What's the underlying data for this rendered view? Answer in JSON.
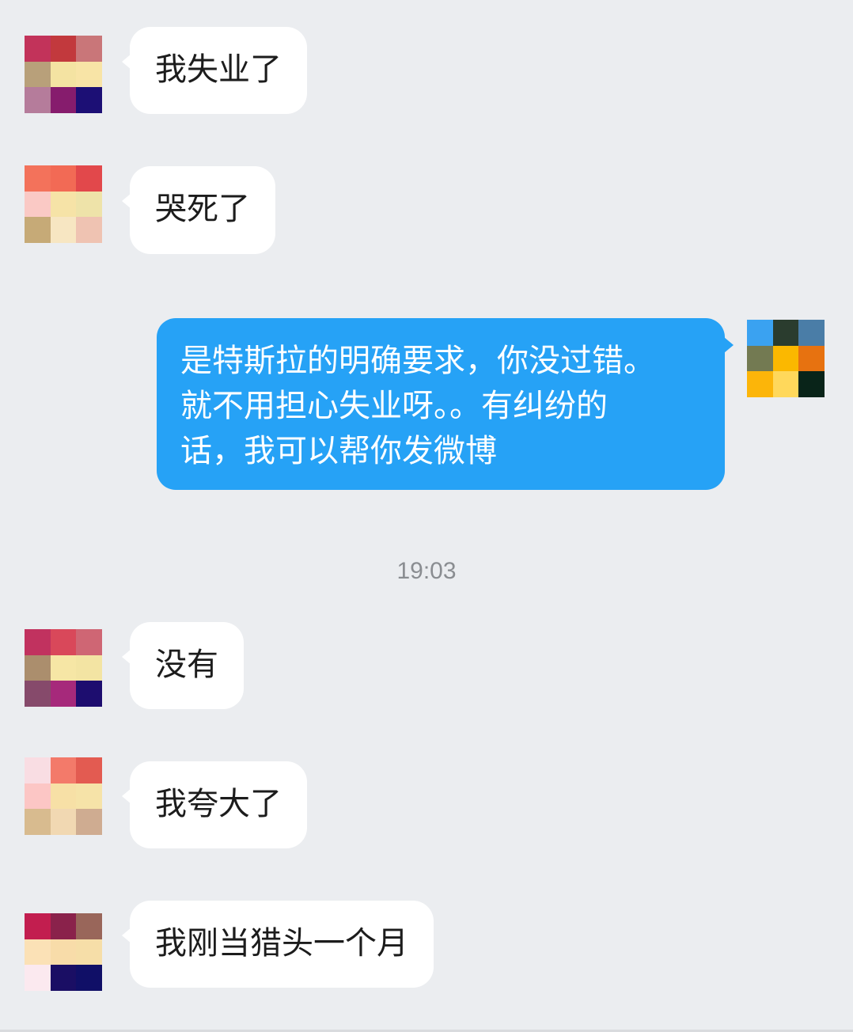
{
  "messages": [
    {
      "direction": "incoming",
      "text": "我失业了",
      "avatar_colors": [
        "#c2335a",
        "#c2393d",
        "#c97679",
        "#b8a07a",
        "#f4e3a2",
        "#f8e4a6",
        "#b57c9b",
        "#861c6d",
        "#1c0f75"
      ]
    },
    {
      "direction": "incoming",
      "text": "哭死了",
      "avatar_colors": [
        "#f3725b",
        "#f26a55",
        "#e2484b",
        "#fac9c5",
        "#f6e3a7",
        "#eee3a9",
        "#c6aa77",
        "#f7e6c2",
        "#efc3b2"
      ]
    },
    {
      "direction": "outgoing",
      "lines": [
        "是特斯拉的明确要求，你没过错。",
        "就不用担心失业呀。。有纠纷的",
        "话，我可以帮你发微博"
      ],
      "avatar_colors": [
        "#3aa2f1",
        "#2a3c2e",
        "#4a7da7",
        "#737a52",
        "#fbb800",
        "#e77210",
        "#fcb509",
        "#ffd85b",
        "#092419"
      ]
    },
    {
      "direction": "incoming",
      "text": "没有",
      "avatar_colors": [
        "#c1325f",
        "#d9485a",
        "#cf6674",
        "#ab8e6d",
        "#f6e6a5",
        "#f3e4a3",
        "#864a6b",
        "#a6297b",
        "#1d0d6f"
      ]
    },
    {
      "direction": "incoming",
      "text": "我夸大了",
      "avatar_colors": [
        "#f9dde3",
        "#f37a6a",
        "#e35b51",
        "#fcc6c5",
        "#f7e0a6",
        "#f6e3a8",
        "#d8bb8f",
        "#f1d8b2",
        "#cfac91"
      ]
    },
    {
      "direction": "incoming",
      "text": "我刚当猎头一个月",
      "avatar_colors": [
        "#c21e4f",
        "#8a224b",
        "#99665a",
        "#fbe1b6",
        "#f8dca9",
        "#f6dea8",
        "#fbe9ef",
        "#1a0e64",
        "#100f67"
      ]
    }
  ],
  "timestamp": "19:03"
}
